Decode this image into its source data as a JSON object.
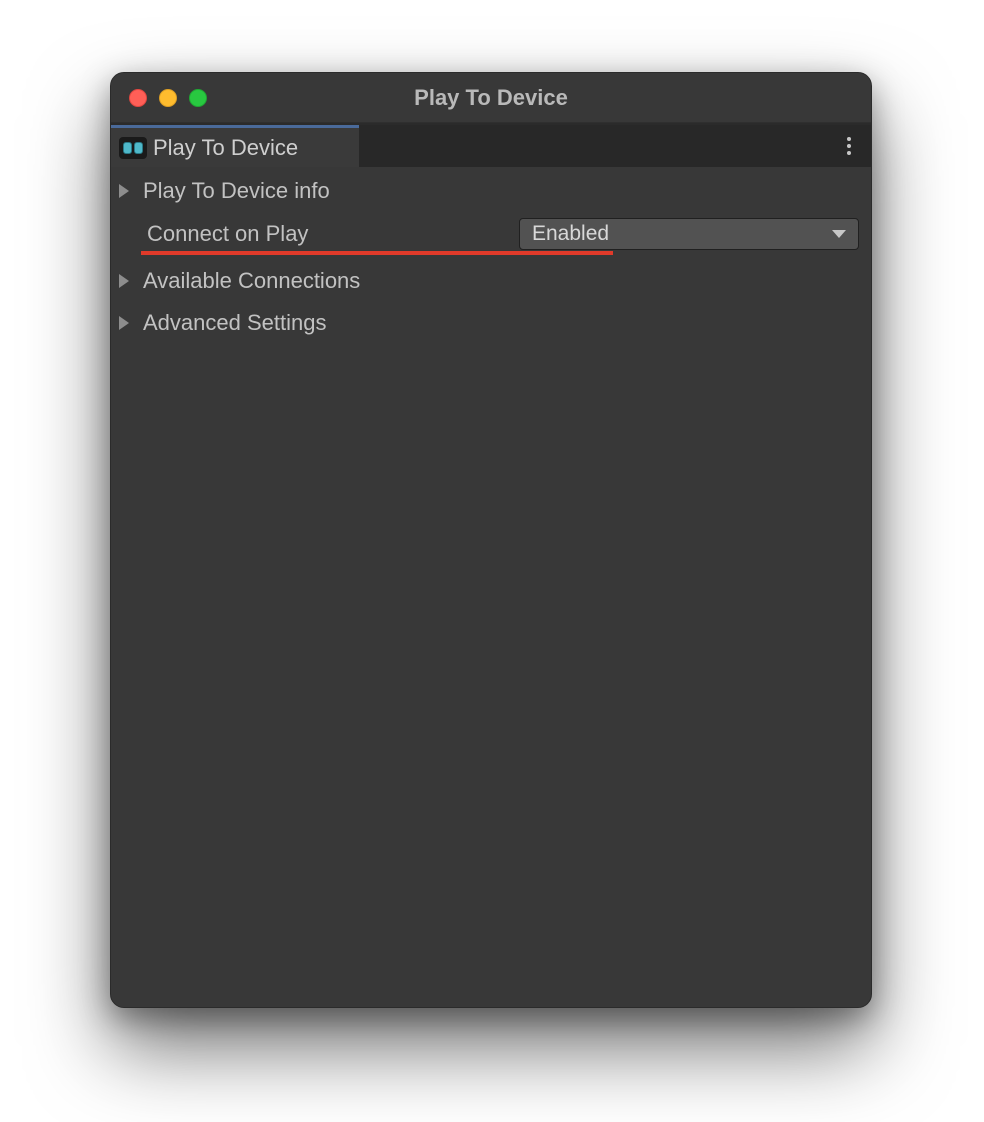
{
  "window": {
    "title": "Play To Device"
  },
  "tab": {
    "label": "Play To Device"
  },
  "section_info": {
    "label": "Play To Device info"
  },
  "field_connect": {
    "label": "Connect on Play",
    "value": "Enabled"
  },
  "section_connections": {
    "label": "Available Connections"
  },
  "section_advanced": {
    "label": "Advanced Settings"
  }
}
